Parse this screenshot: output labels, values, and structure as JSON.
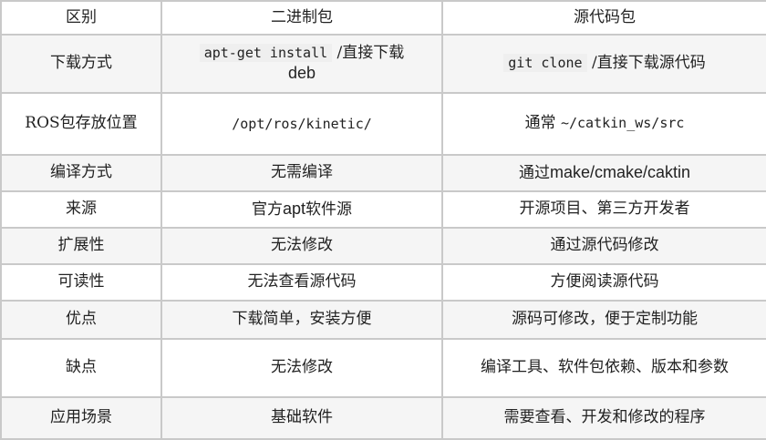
{
  "table": {
    "headers": [
      "区别",
      "二进制包",
      "源代码包"
    ],
    "rows": [
      {
        "label": "下载方式",
        "binary_code": "apt-get install",
        "binary_text": " /直接下载",
        "binary_text2": "deb",
        "source_code": "git clone",
        "source_text": " /直接下载源代码"
      },
      {
        "label": "ROS包存放位置",
        "binary": "/opt/ros/kinetic/",
        "source_text": "通常 ",
        "source_code": "~/catkin_ws/src"
      },
      {
        "label": "编译方式",
        "binary": "无需编译",
        "source_text": "通过",
        "source_latin": "make/cmake/caktin"
      },
      {
        "label": "来源",
        "binary_text": "官方",
        "binary_latin": "apt",
        "binary_text2": "软件源",
        "source": "开源项目、第三方开发者"
      },
      {
        "label": "扩展性",
        "binary": "无法修改",
        "source": "通过源代码修改"
      },
      {
        "label": "可读性",
        "binary": "无法查看源代码",
        "source": "方便阅读源代码"
      },
      {
        "label": "优点",
        "binary": "下载简单，安装方便",
        "source": "源码可修改，便于定制功能"
      },
      {
        "label": "缺点",
        "binary": "无法修改",
        "source": "编译工具、软件包依赖、版本和参数"
      },
      {
        "label": "应用场景",
        "binary": "基础软件",
        "source": "需要查看、开发和修改的程序"
      }
    ]
  }
}
